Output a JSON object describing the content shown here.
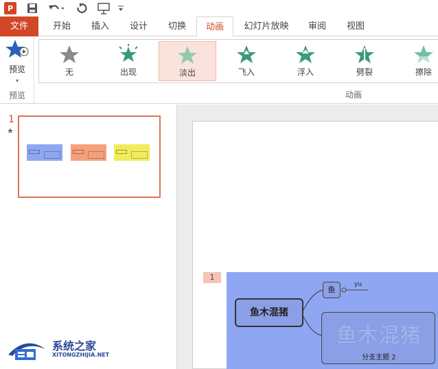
{
  "qat": {
    "app_letter": "P",
    "icons": [
      "powerpoint-icon",
      "save-icon",
      "undo-icon",
      "redo-icon",
      "start-slideshow-icon",
      "customize-qat-icon"
    ]
  },
  "tabs": [
    {
      "label": "文件"
    },
    {
      "label": "开始"
    },
    {
      "label": "插入"
    },
    {
      "label": "设计"
    },
    {
      "label": "切换"
    },
    {
      "label": "动画"
    },
    {
      "label": "幻灯片放映"
    },
    {
      "label": "审阅"
    },
    {
      "label": "视图"
    }
  ],
  "active_tab": "动画",
  "ribbon": {
    "preview_label": "预览",
    "preview_group_label": "预览",
    "animation_group_label": "动画",
    "animations": [
      {
        "label": "无",
        "color": "#8a8a8a"
      },
      {
        "label": "出现",
        "color": "#3b9a7a"
      },
      {
        "label": "淡出",
        "color": "#6fc0a0"
      },
      {
        "label": "飞入",
        "color": "#3b9a7a"
      },
      {
        "label": "浮入",
        "color": "#3b9a7a"
      },
      {
        "label": "劈裂",
        "color": "#3b9a7a"
      },
      {
        "label": "擦除",
        "color": "#6fc0a0"
      }
    ],
    "selected_animation": "淡出"
  },
  "thumbnails": {
    "slide_number": "1",
    "animation_marker": "★"
  },
  "slide": {
    "animation_badge": "1",
    "central_topic": "鱼木混猪",
    "node_fish": "鱼",
    "node_fish_note": "yu",
    "branch_big_text": "鱼木混猪",
    "branch_sub": "分支主题 2"
  },
  "watermark": {
    "title": "系统之家",
    "url": "XITONGZHIJIA.NET"
  },
  "colors": {
    "accent": "#d24726",
    "mindmap_bg": "#8fa7f2",
    "thumb_orange": "#f4a17b",
    "thumb_yellow": "#f1ec5c"
  }
}
